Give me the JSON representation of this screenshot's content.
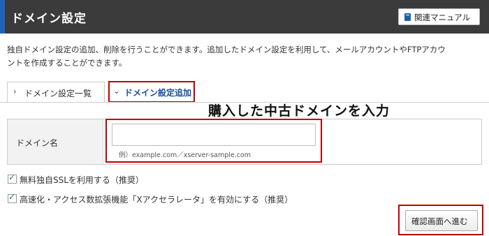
{
  "header": {
    "title": "ドメイン設定",
    "manual_button": "関連マニュアル",
    "manual_icon": "book-icon"
  },
  "description": {
    "line1": "独自ドメイン設定の追加、削除を行うことができます。追加したドメイン設定を利用して、メールアカウントやFTPアカウ",
    "line2": "ントを作成することができます。"
  },
  "tabs": [
    {
      "label": "ドメイン設定一覧",
      "icon": "chevron-right-icon"
    },
    {
      "label": "ドメイン設定追加",
      "icon": "chevron-down-icon",
      "active": true
    }
  ],
  "annotation": "購入した中古ドメインを入力",
  "form": {
    "domain_label": "ドメイン名",
    "domain_value": "",
    "example": "例）example.com／xserver-sample.com"
  },
  "options": [
    {
      "label": "無料独自SSLを利用する（推奨）",
      "checked": true
    },
    {
      "label": "高速化・アクセス数拡張機能「Xアクセラレータ」を有効にする（推奨）",
      "checked": true
    }
  ],
  "confirm_button": "確認画面へ進む",
  "colors": {
    "header_bg": "#3b3b3b",
    "accent_blue": "#1f63b8",
    "highlight_red": "#c40000",
    "check_green": "#1a8f2e"
  }
}
